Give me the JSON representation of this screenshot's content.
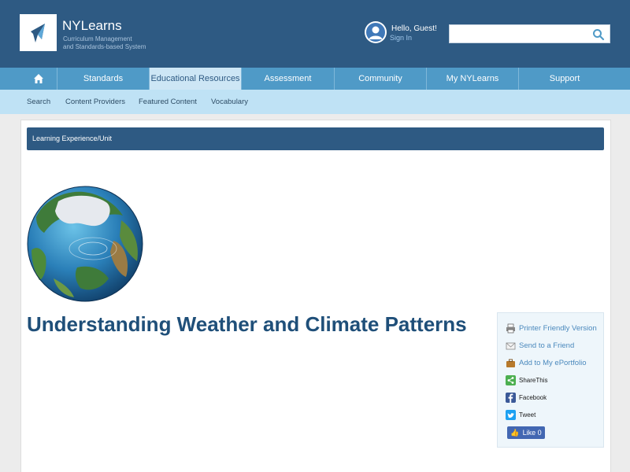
{
  "header": {
    "brand": "NYLearns",
    "tagline_line1": "Curriculum Management",
    "tagline_line2": "and Standards-based System",
    "greeting": "Hello,  Guest!",
    "signin": "Sign In",
    "search_value": ""
  },
  "nav": {
    "items": [
      "Standards",
      "Educational Resources",
      "Assessment",
      "Community",
      "My NYLearns",
      "Support"
    ],
    "active": "Educational Resources"
  },
  "subnav": {
    "items": [
      "Search",
      "Content Providers",
      "Featured Content",
      "Vocabulary"
    ]
  },
  "section": {
    "label": "Learning Experience/Unit"
  },
  "page": {
    "title": "Understanding Weather and Climate Patterns"
  },
  "sidebar": {
    "printer": "Printer Friendly Version",
    "send": "Send to a Friend",
    "portfolio": "Add to My ePortfolio",
    "sharethis": "ShareThis",
    "facebook": "Facebook",
    "tweet": "Tweet",
    "like": "Like 0"
  },
  "colors": {
    "header": "#2e5a83",
    "nav": "#4f9ac7",
    "subnav": "#bfe2f5",
    "link": "#4b89bd"
  }
}
